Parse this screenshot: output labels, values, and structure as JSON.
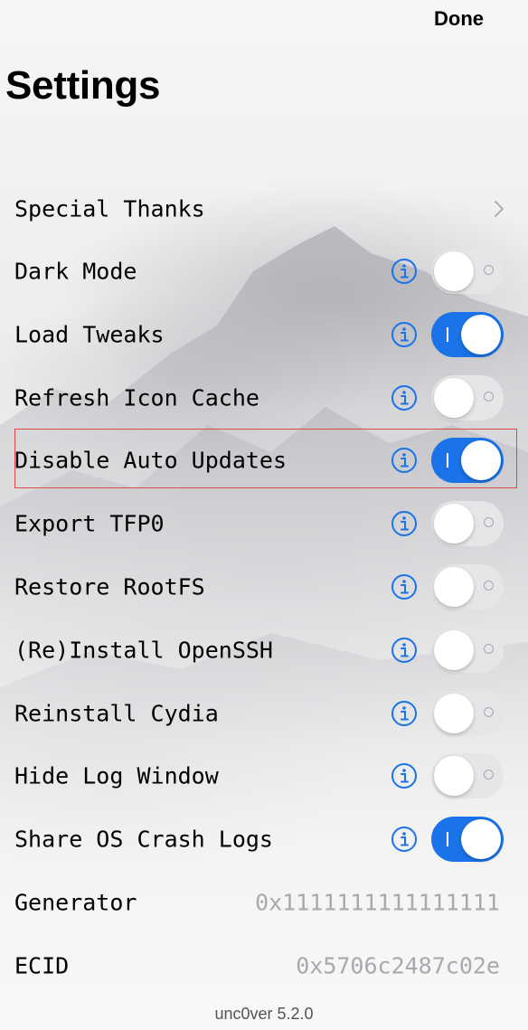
{
  "nav": {
    "done_label": "Done"
  },
  "title": "Settings",
  "link_row": {
    "label": "Special Thanks",
    "icon": "chevron-right-icon"
  },
  "toggles": [
    {
      "label": "Dark Mode",
      "on": false
    },
    {
      "label": "Load Tweaks",
      "on": true
    },
    {
      "label": "Refresh Icon Cache",
      "on": false
    },
    {
      "label": "Disable Auto Updates",
      "on": true,
      "highlighted": true
    },
    {
      "label": "Export TFP0",
      "on": false
    },
    {
      "label": "Restore RootFS",
      "on": false
    },
    {
      "label": "(Re)Install OpenSSH",
      "on": false
    },
    {
      "label": "Reinstall Cydia",
      "on": false
    },
    {
      "label": "Hide Log Window",
      "on": false
    },
    {
      "label": "Share OS Crash Logs",
      "on": true
    }
  ],
  "values": [
    {
      "label": "Generator",
      "value": "0x1111111111111111"
    },
    {
      "label": "ECID",
      "value": "0x5706c2487c02e"
    }
  ],
  "footer": {
    "version": "unc0ver 5.2.0"
  },
  "colors": {
    "accent": "#1a73e8",
    "toggle_off": "#e6e6e8",
    "highlight": "#e04848"
  }
}
